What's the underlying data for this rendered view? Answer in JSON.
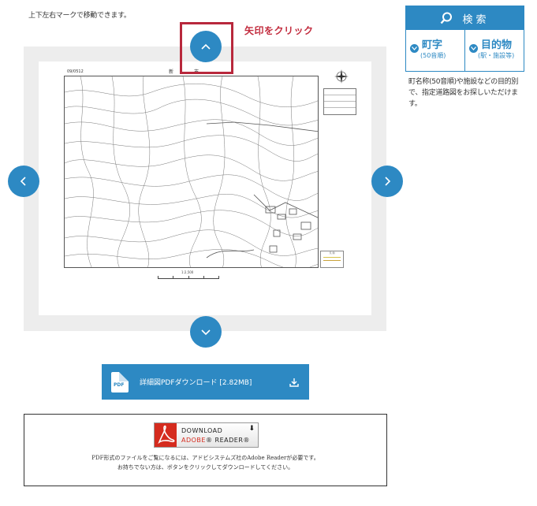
{
  "instruction": "上下左右マークで移動できます。",
  "callout": "矢印をクリック",
  "map": {
    "sheet_code": "09/0512",
    "sheet_title": "新　　　市",
    "scale": "1:2,500"
  },
  "download": {
    "icon_text": "PDF",
    "label": "詳細図PDFダウンロード [2.82MB]"
  },
  "adobe": {
    "download_text": "DOWNLOAD",
    "reader_brand": "ADOBE",
    "reader_text": "READER",
    "note1": "PDF形式のファイルをご覧になるには、アドビシステムズ社のAdobe Readerが必要です。",
    "note2": "お持ちでない方は、ボタンをクリックしてダウンロードしてください。"
  },
  "search": {
    "title": "検索",
    "tabs": [
      {
        "label": "町字",
        "sub": "(50音順)"
      },
      {
        "label": "目的物",
        "sub": "(駅・施設等)"
      }
    ],
    "description": "町名称(50音順)や施設などの目的別で、指定道路図をお探しいただけます。"
  },
  "colors": {
    "accent": "#2d89c3",
    "highlight": "#b8283c",
    "viewer_bg": "#ededed"
  }
}
